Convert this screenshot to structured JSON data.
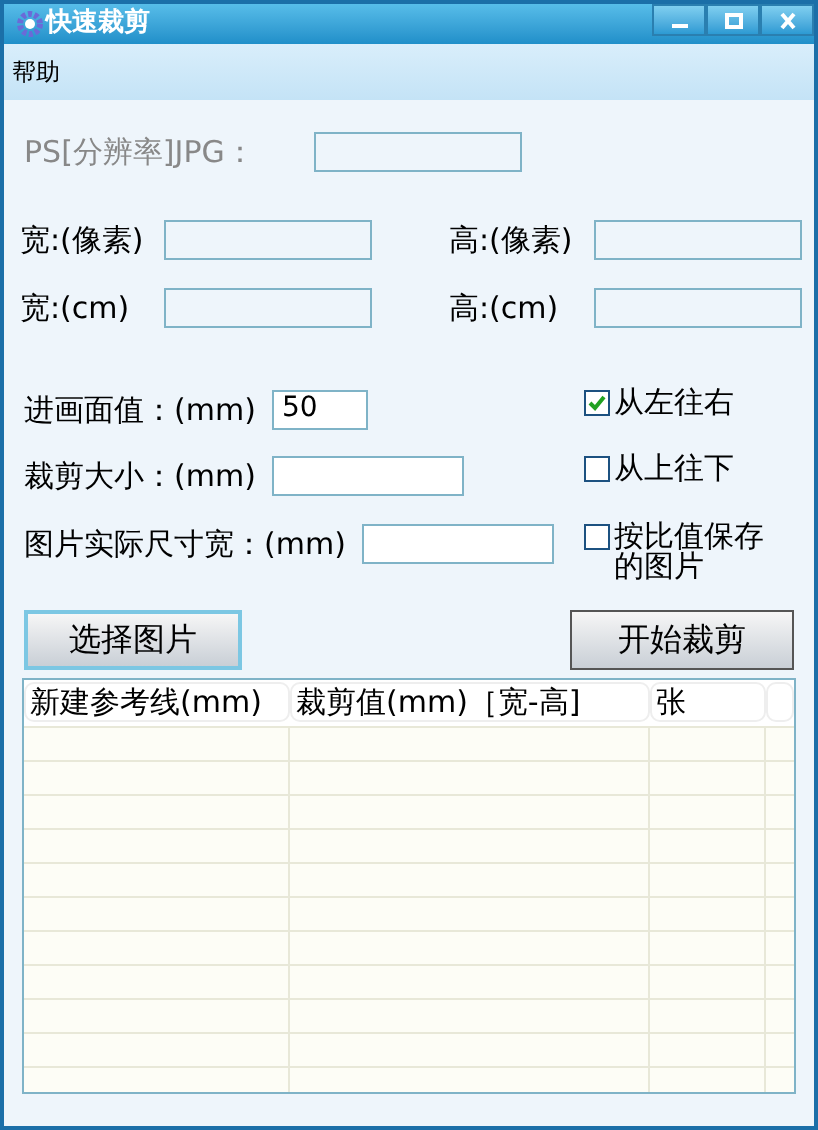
{
  "window": {
    "title": "快速裁剪"
  },
  "menu": [
    "帮助"
  ],
  "ps_field": {
    "label": "PS[分辨率]JPG："
  },
  "fields": [
    {
      "label": "宽:(像素)"
    },
    {
      "label": "高:(像素)"
    },
    {
      "label": "宽:(cm)"
    },
    {
      "label": "高:(cm)"
    }
  ],
  "options": [
    {
      "label": "进画面值：(mm)",
      "value": "50",
      "checkbox": "从左往右",
      "checked": true
    },
    {
      "label": "裁剪大小：(mm)",
      "checkbox": "从上往下",
      "checked": false
    },
    {
      "label": "图片实际尺寸宽：(mm)",
      "checkbox": "按比值保存的图片",
      "checked": false
    }
  ],
  "buttons": [
    {
      "label": "选择图片",
      "selected": true
    },
    {
      "label": "开始裁剪",
      "selected": false
    }
  ],
  "table": {
    "columns": [
      "新建参考线(mm)",
      "裁剪值(mm)［宽-高]",
      "张"
    ]
  }
}
